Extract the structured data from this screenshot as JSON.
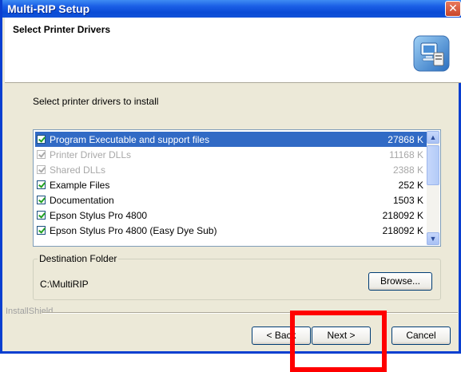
{
  "window": {
    "title": "Multi-RIP Setup"
  },
  "header": {
    "title": "Select Printer Drivers",
    "icon": "setup-computer-icon"
  },
  "instruction": "Select printer drivers to install",
  "components": [
    {
      "name": "Program Executable and support files",
      "size": "27868 K",
      "checked": true,
      "selected": true,
      "enabled": true
    },
    {
      "name": "Printer Driver DLLs",
      "size": "11168 K",
      "checked": true,
      "selected": false,
      "enabled": false
    },
    {
      "name": "Shared DLLs",
      "size": "2388 K",
      "checked": true,
      "selected": false,
      "enabled": false
    },
    {
      "name": "Example Files",
      "size": "252 K",
      "checked": true,
      "selected": false,
      "enabled": true
    },
    {
      "name": "Documentation",
      "size": "1503 K",
      "checked": true,
      "selected": false,
      "enabled": true
    },
    {
      "name": "Epson Stylus Pro 4800",
      "size": "218092 K",
      "checked": true,
      "selected": false,
      "enabled": true
    },
    {
      "name": "Epson Stylus Pro 4800 (Easy Dye Sub)",
      "size": "218092 K",
      "checked": true,
      "selected": false,
      "enabled": true
    }
  ],
  "destination": {
    "legend": "Destination Folder",
    "path": "C:\\MultiRIP",
    "browse_label": "Browse..."
  },
  "installshield_label": "InstallShield",
  "buttons": {
    "back": "< Back",
    "next": "Next >",
    "cancel": "Cancel"
  },
  "colors": {
    "title_bar": "#0a4bd6",
    "selection": "#316ac5",
    "highlight_box": "#ff0000"
  }
}
